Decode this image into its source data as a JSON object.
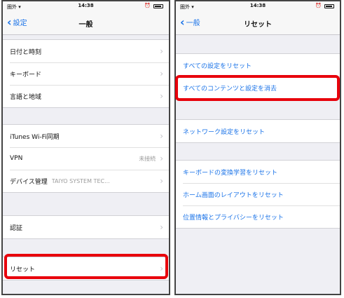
{
  "status": {
    "carrier": "圏外 ▾",
    "time": "14:38",
    "alarm": "⏰"
  },
  "left": {
    "nav": {
      "back_label": "設定",
      "title": "一般"
    },
    "group1": [
      "日付と時刻",
      "キーボード",
      "言語と地域"
    ],
    "group2": [
      {
        "label": "iTunes Wi-Fi同期",
        "value": ""
      },
      {
        "label": "VPN",
        "value": "未接続"
      },
      {
        "label": "デバイス管理",
        "value": "TAIYO SYSTEM TEC..."
      }
    ],
    "group3": [
      "認証"
    ],
    "group4": [
      "リセット"
    ]
  },
  "right": {
    "nav": {
      "back_label": "一般",
      "title": "リセット"
    },
    "group1": [
      "すべての設定をリセット",
      "すべてのコンテンツと設定を消去"
    ],
    "group2": [
      "ネットワーク設定をリセット"
    ],
    "group3": [
      "キーボードの変換学習をリセット",
      "ホーム画面のレイアウトをリセット",
      "位置情報とプライバシーをリセット"
    ]
  },
  "colors": {
    "accent": "#1a73e8",
    "highlight": "#e8000b"
  },
  "icons": {
    "back": "chevron-left-icon",
    "disclosure": "chevron-right-icon"
  }
}
